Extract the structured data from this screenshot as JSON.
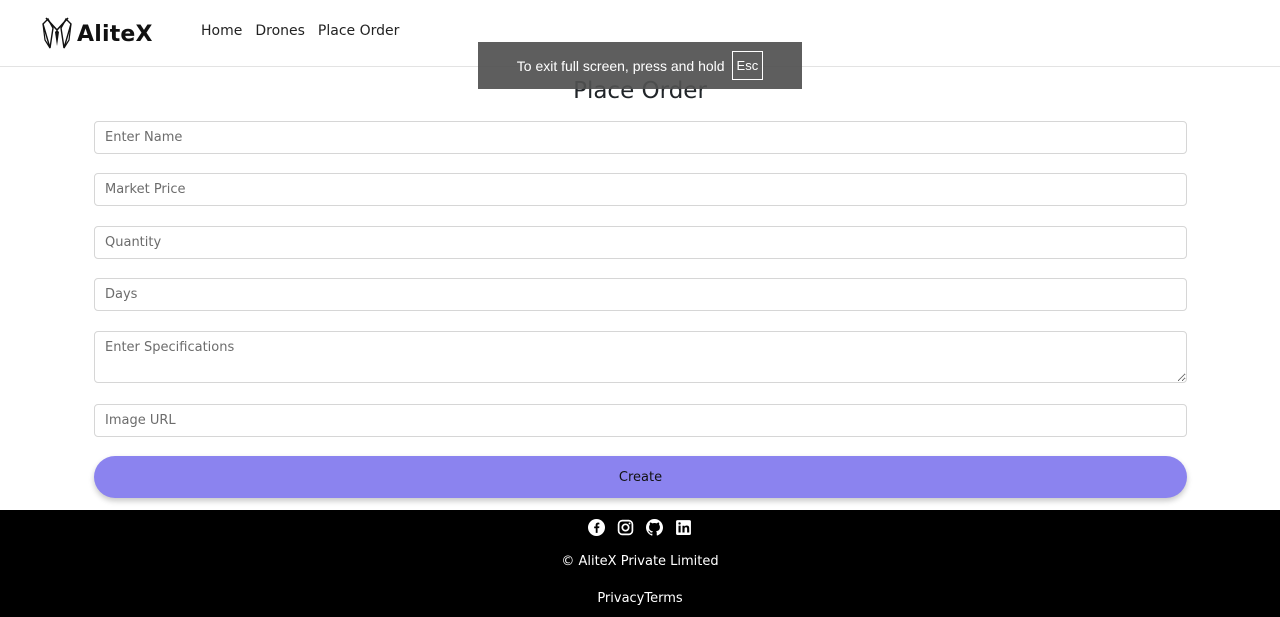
{
  "brand": {
    "name": "AliteX"
  },
  "nav": {
    "items": [
      "Home",
      "Drones",
      "Place Order"
    ]
  },
  "fullscreen_notice": {
    "text": "To exit full screen, press and hold",
    "key": "Esc"
  },
  "page": {
    "title": "Place Order"
  },
  "form": {
    "name_placeholder": "Enter Name",
    "price_placeholder": "Market Price",
    "quantity_placeholder": "Quantity",
    "days_placeholder": "Days",
    "specs_placeholder": "Enter Specifications",
    "image_placeholder": "Image URL",
    "submit_label": "Create",
    "submit_color": "#8b83ef"
  },
  "footer": {
    "social_icons": [
      "facebook-icon",
      "instagram-icon",
      "github-icon",
      "linkedin-icon"
    ],
    "copyright": "© AliteX Private Limited",
    "privacy": "Privacy",
    "terms": "Terms"
  }
}
